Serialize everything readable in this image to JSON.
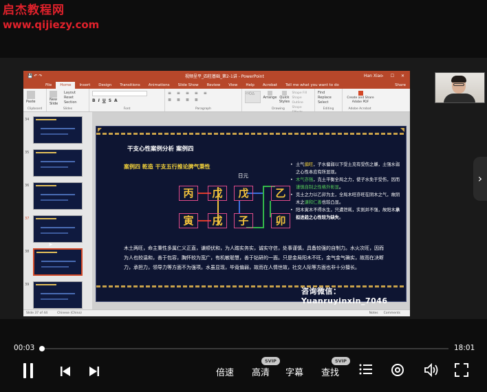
{
  "watermark": {
    "line1": "启杰教程网",
    "line2": "www.qijiezy.com"
  },
  "ppt": {
    "doc_title": "视频呈平_四柱基础_第2-1讲 - PowerPoint",
    "user": "Han Xiao",
    "window_buttons": "– ☐ ✕",
    "tabs": [
      "File",
      "Home",
      "Insert",
      "Design",
      "Transitions",
      "Animations",
      "Slide Show",
      "Review",
      "View",
      "Help",
      "Acrobat"
    ],
    "tell_me": "Tell me what you want to do",
    "share": "Share",
    "ribbon": {
      "clipboard": "Clipboard",
      "paste": "Paste",
      "new_slide": "New Slide",
      "layout": "Layout",
      "reset": "Reset",
      "section": "Section",
      "slides": "Slides",
      "font": "Font",
      "paragraph": "Paragraph",
      "drawing": "Drawing",
      "arrange": "Arrange",
      "quick_styles": "Quick Styles",
      "shape_fill": "Shape Fill",
      "shape_outline": "Shape Outline",
      "shape_effects": "Shape Effects",
      "find": "Find",
      "replace": "Replace",
      "select": "Select",
      "editing": "Editing",
      "create_share": "Create and Share Adobe PDF",
      "adobe_acrobat": "Adobe Acrobat"
    },
    "thumbs": [
      "34",
      "35",
      "36",
      "37",
      "38",
      "39"
    ],
    "status": {
      "slide": "Slide 37 of 44",
      "lang": "Chinese (China)",
      "notes": "Notes",
      "comments": "Comments"
    }
  },
  "slide": {
    "title": "干支心性案例分析  案例四",
    "subtitle": "案例四 乾造 干支五行推论脾气秉性",
    "riyuan": "日元",
    "stems": [
      "丙",
      "戊",
      "戊",
      "乙"
    ],
    "branches": [
      "寅",
      "戌",
      "子",
      "卯"
    ],
    "bullets": [
      {
        "parts": [
          {
            "t": "土气",
            "c": ""
          },
          {
            "t": "偏旺",
            "c": "y"
          },
          {
            "t": "，子水偏弱以下受土克有受伤之嫌，土强水弱之心性本应有所显现。",
            "c": ""
          }
        ]
      },
      {
        "parts": [
          {
            "t": "木气亦强",
            "c": "g"
          },
          {
            "t": "，克土平衡全局之力，使子水免于受伤，因而",
            "c": ""
          },
          {
            "t": "谨慎自制之性格外彰显",
            "c": "g"
          },
          {
            "t": "。",
            "c": ""
          }
        ]
      },
      {
        "parts": [
          {
            "t": "克土之力以乙卯为主，全局木旺亦旺在阴木之气，故阴木之",
            "c": ""
          },
          {
            "t": "谦和仁善",
            "c": "g"
          },
          {
            "t": "也较凸显。",
            "c": ""
          }
        ]
      },
      {
        "parts": [
          {
            "t": "阳木寅木不得水生，只遭泄耗，实则并不强，故阳木",
            "c": ""
          },
          {
            "t": "承担进趋之心性较为缺失",
            "c": "w"
          },
          {
            "t": "。",
            "c": ""
          }
        ]
      }
    ],
    "paragraph": "木土两旺，命主秉性多属仁义正直，谦顺伏和，为人踏实务实，诚实守信，处事谨慎，具备较强的自制力。水火次旺，因而为人也较温和，善于包容，胸怀较为宽广，有机敏聪慧，善于钻研的一面。只是金局阳木不旺，金气金气确实，故而在决断力，承担力，领导力等方面不为强项。水虽显现，毕竟偏弱，故而在人情世故，社交人际等方面也非十分擅长。",
    "contact": "咨询微信：Yuanruyinxin_7046"
  },
  "player": {
    "time_current": "00:03",
    "time_total": "18:01",
    "progress": 0.003,
    "speed": "倍速",
    "quality": "高清",
    "subtitles": "字幕",
    "search": "查找",
    "svip": "SVIP"
  },
  "colors": {
    "accent": "#b7472a",
    "slide_bg": "#0e1532",
    "gold": "#f2c23b"
  }
}
